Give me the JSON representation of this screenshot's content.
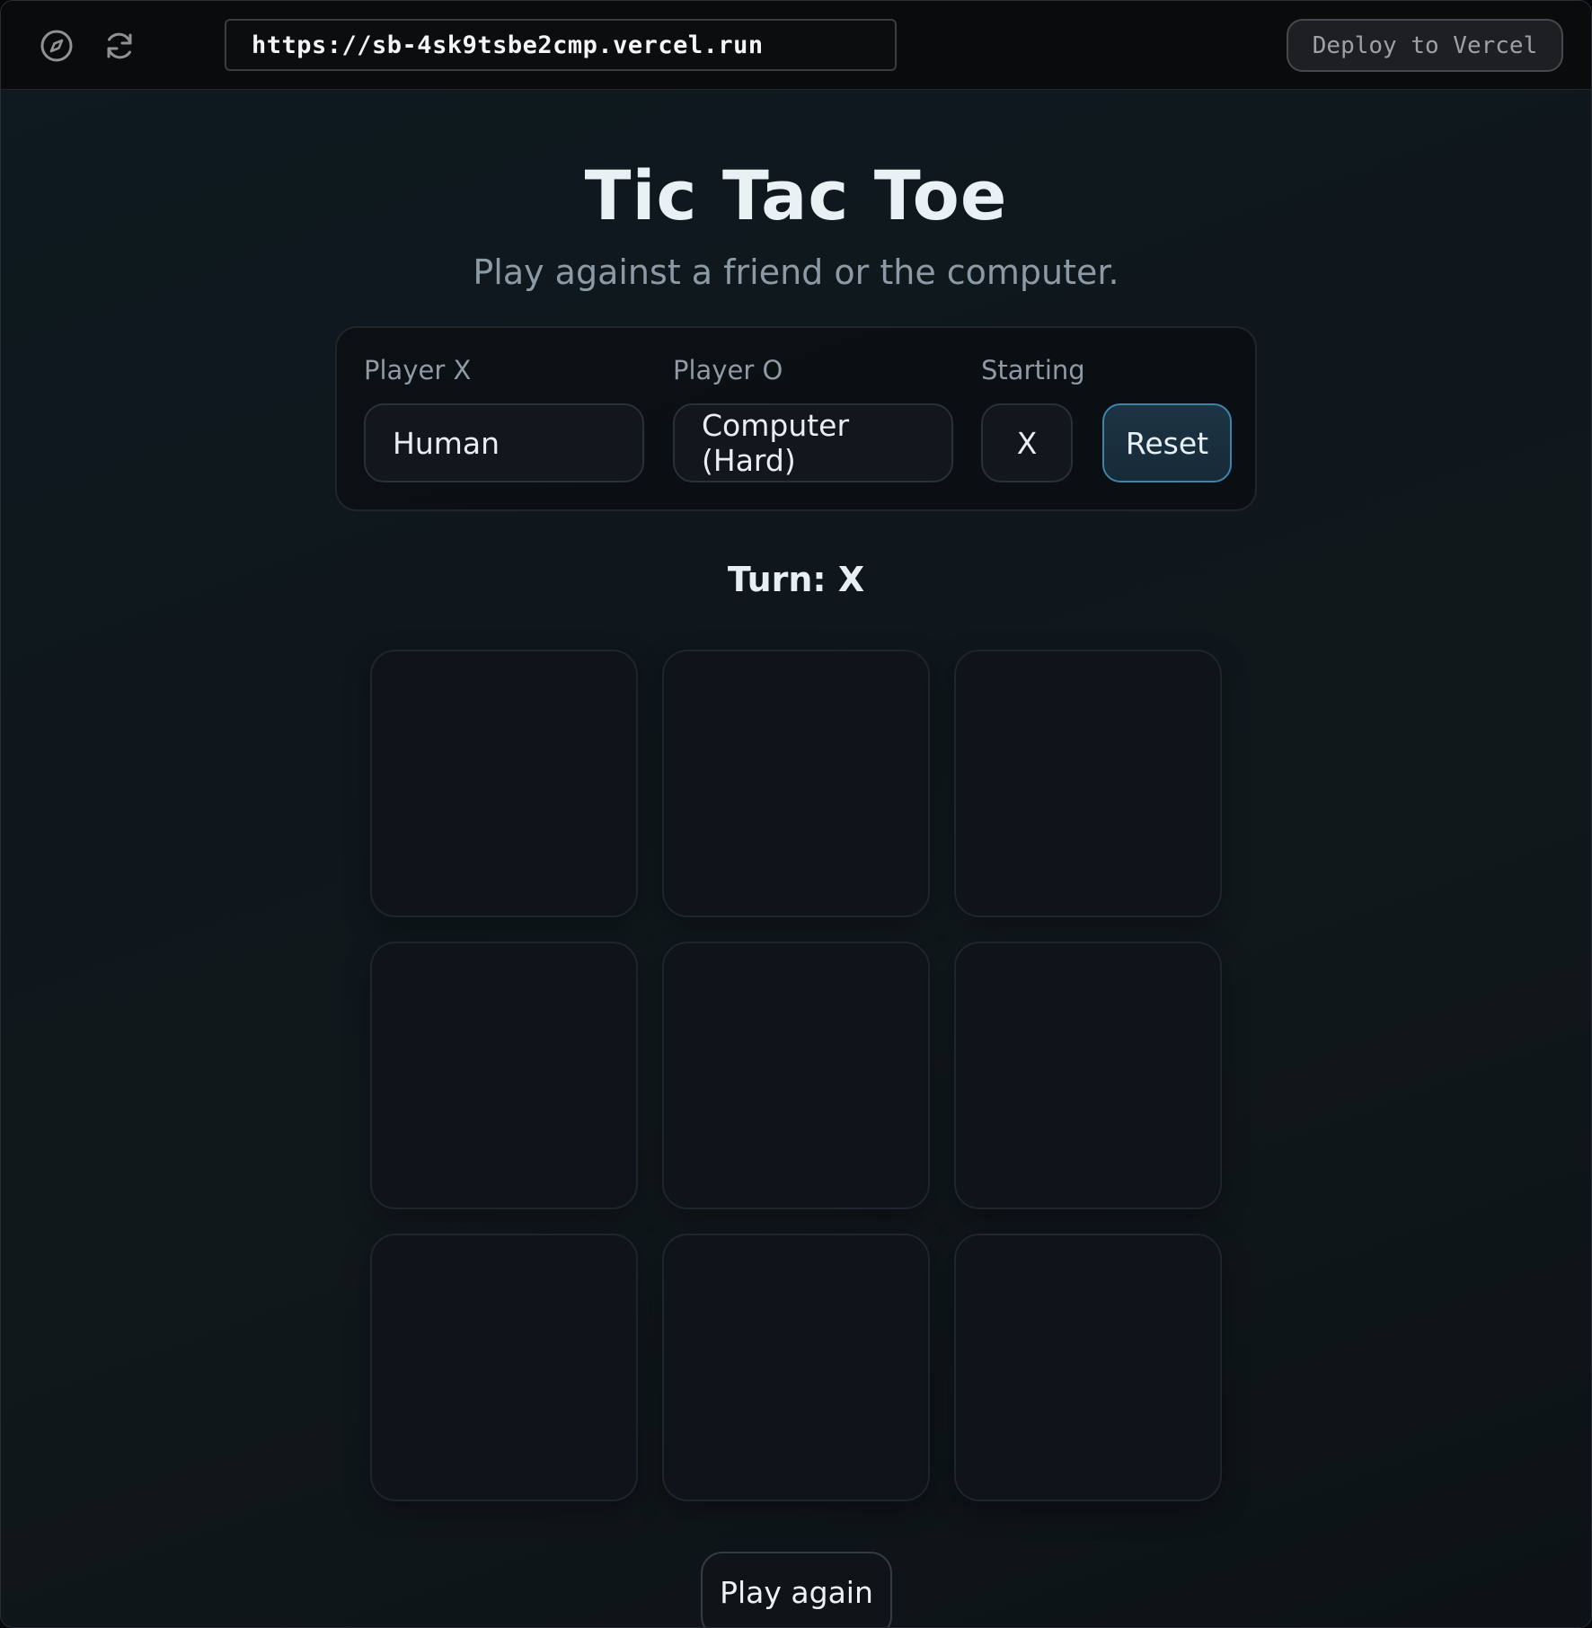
{
  "browser": {
    "url": "https://sb-4sk9tsbe2cmp.vercel.run",
    "deploy_label": "Deploy to Vercel",
    "icons": [
      "compass-icon",
      "refresh-icon"
    ]
  },
  "game": {
    "title": "Tic Tac Toe",
    "subtitle": "Play against a friend or the computer.",
    "controls": {
      "player_x_label": "Player X",
      "player_x_value": "Human",
      "player_o_label": "Player O",
      "player_o_value": "Computer (Hard)",
      "starting_label": "Starting",
      "starting_value": "X",
      "reset_label": "Reset"
    },
    "turn_text": "Turn: X",
    "board": [
      "",
      "",
      "",
      "",
      "",
      "",
      "",
      "",
      ""
    ],
    "play_again_label": "Play again"
  },
  "colors": {
    "background": "#0f171c",
    "accent": "#3f84a8",
    "text": "#eaf1f4",
    "muted": "#8c9aa6"
  }
}
